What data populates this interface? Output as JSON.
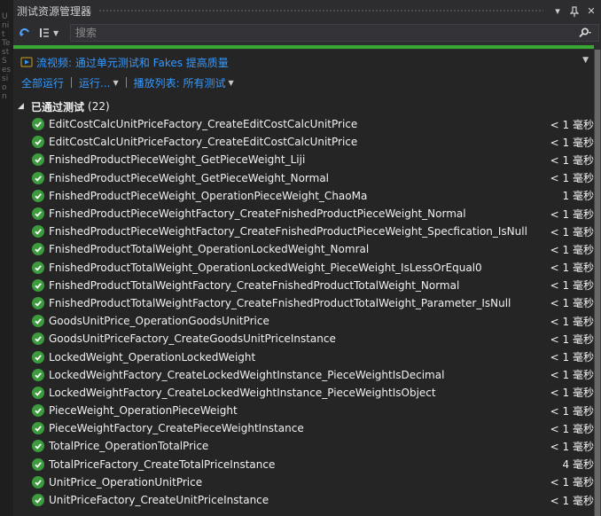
{
  "window": {
    "title": "测试资源管理器",
    "side_text": "Unit Test Session"
  },
  "toolbar": {
    "search_placeholder": "搜索"
  },
  "progress": {
    "fraction": 1.0,
    "color": "#37a832"
  },
  "promo": {
    "text": "流视频: 通过单元测试和 Fakes 提高质量"
  },
  "actions": {
    "run_all": "全部运行",
    "run": "运行...",
    "playlist": "播放列表: 所有测试"
  },
  "group": {
    "title": "已通过测试",
    "count": "(22)"
  },
  "tests": [
    {
      "name": "EditCostCalcUnitPriceFactory_CreateEditCostCalcUnitPrice",
      "duration": "< 1 毫秒"
    },
    {
      "name": "EditCostCalcUnitPriceFactory_CreateEditCostCalcUnitPrice",
      "duration": "< 1 毫秒"
    },
    {
      "name": "FnishedProductPieceWeight_GetPieceWeight_Liji",
      "duration": "< 1 毫秒"
    },
    {
      "name": "FnishedProductPieceWeight_GetPieceWeight_Normal",
      "duration": "< 1 毫秒"
    },
    {
      "name": "FnishedProductPieceWeight_OperationPieceWeight_ChaoMa",
      "duration": "1 毫秒"
    },
    {
      "name": "FnishedProductPieceWeightFactory_CreateFnishedProductPieceWeight_Normal",
      "duration": "< 1 毫秒"
    },
    {
      "name": "FnishedProductPieceWeightFactory_CreateFnishedProductPieceWeight_Specfication_IsNull",
      "duration": "< 1 毫秒"
    },
    {
      "name": "FnishedProductTotalWeight_OperationLockedWeight_Nomral",
      "duration": "< 1 毫秒"
    },
    {
      "name": "FnishedProductTotalWeight_OperationLockedWeight_PieceWeight_IsLessOrEqual0",
      "duration": "< 1 毫秒"
    },
    {
      "name": "FnishedProductTotalWeightFactory_CreateFnishedProductTotalWeight_Normal",
      "duration": "< 1 毫秒"
    },
    {
      "name": "FnishedProductTotalWeightFactory_CreateFnishedProductTotalWeight_Parameter_IsNull",
      "duration": "< 1 毫秒"
    },
    {
      "name": "GoodsUnitPrice_OperationGoodsUnitPrice",
      "duration": "< 1 毫秒"
    },
    {
      "name": "GoodsUnitPriceFactory_CreateGoodsUnitPriceInstance",
      "duration": "< 1 毫秒"
    },
    {
      "name": "LockedWeight_OperationLockedWeight",
      "duration": "< 1 毫秒"
    },
    {
      "name": "LockedWeightFactory_CreateLockedWeightInstance_PieceWeightIsDecimal",
      "duration": "< 1 毫秒"
    },
    {
      "name": "LockedWeightFactory_CreateLockedWeightInstance_PieceWeightIsObject",
      "duration": "< 1 毫秒"
    },
    {
      "name": "PieceWeight_OperationPieceWeight",
      "duration": "< 1 毫秒"
    },
    {
      "name": "PieceWeightFactory_CreatePieceWeightInstance",
      "duration": "< 1 毫秒"
    },
    {
      "name": "TotalPrice_OperationTotalPrice",
      "duration": "< 1 毫秒"
    },
    {
      "name": "TotalPriceFactory_CreateTotalPriceInstance",
      "duration": "4 毫秒"
    },
    {
      "name": "UnitPrice_OperationUnitPrice",
      "duration": "< 1 毫秒"
    },
    {
      "name": "UnitPriceFactory_CreateUnitPriceInstance",
      "duration": "< 1 毫秒"
    }
  ],
  "colors": {
    "background": "#2d2d30",
    "panel": "#252526",
    "link": "#3399ff",
    "pass": "#3c9b3c"
  },
  "icons": {
    "refresh": "refresh-icon",
    "group_by": "group-by-icon",
    "search": "search-icon",
    "promo": "video-icon",
    "pass": "check-circle-icon"
  }
}
